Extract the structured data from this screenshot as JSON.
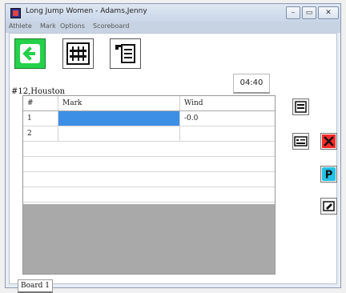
{
  "window": {
    "title": "Long Jump Women - Adams,Jenny",
    "controls": [
      "–",
      "▭",
      "✕"
    ]
  },
  "menu": [
    "Athlete",
    "Mark",
    "Options",
    "Scoreboard"
  ],
  "toolbar": {
    "buttons": [
      {
        "icon": "back-arrow-icon",
        "color": "#22d04a"
      },
      {
        "icon": "measure-keypad-icon"
      },
      {
        "icon": "flag-list-icon"
      }
    ]
  },
  "timer": "04:40",
  "athlete_label": "#12,Houston",
  "table": {
    "headers": [
      "#",
      "Mark",
      "Wind"
    ],
    "rows": [
      {
        "num": "1",
        "mark": "",
        "wind": "-0.0",
        "selected": true
      },
      {
        "num": "2",
        "mark": "",
        "wind": ""
      }
    ]
  },
  "side_buttons": [
    {
      "icon": "measure-icon"
    },
    {
      "icon": "tape-icon"
    },
    {
      "icon": "delete-x-icon",
      "color": "#ff2b2b"
    },
    {
      "icon": "p-icon",
      "color": "#25c0e5"
    },
    {
      "icon": "eraser-icon"
    }
  ],
  "bottom_tab": "Board 1",
  "colors": {
    "selected_cell": "#3d8fe6",
    "grid_empty": "#a9a9a9"
  }
}
